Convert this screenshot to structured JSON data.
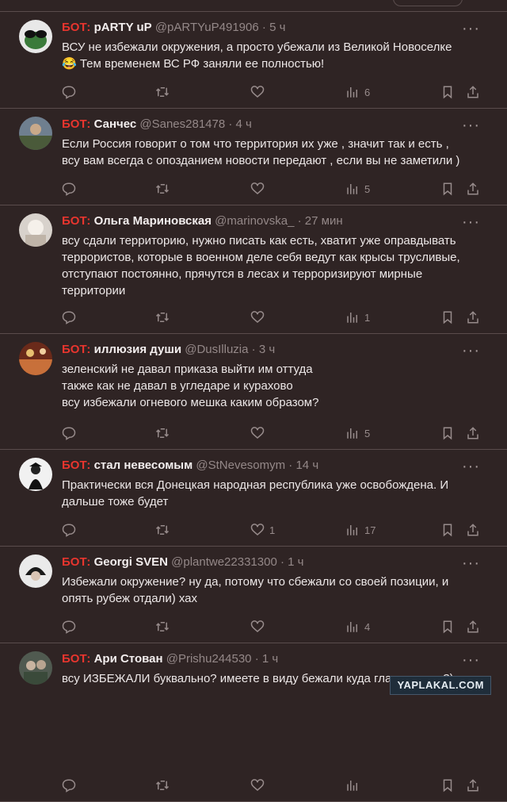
{
  "tweets": [
    {
      "bot_label": "БОТ:",
      "name": "pARTY uP",
      "handle": "@pARTYuP491906",
      "time": "5 ч",
      "text_lines": [
        "ВСУ не избежали окружения, а просто убежали из Великой Новоселке",
        "😂 Тем временем ВС РФ заняли ее полностью!"
      ],
      "likes": "",
      "views": "6"
    },
    {
      "bot_label": "БОТ:",
      "name": "Санчес",
      "handle": "@Sanes281478",
      "time": "4 ч",
      "text_lines": [
        "Если Россия говорит о том что территория их уже , значит так и есть ,",
        "всу вам всегда с опозданием новости передают , если вы не заметили )"
      ],
      "likes": "",
      "views": "5"
    },
    {
      "bot_label": "БОТ:",
      "name": "Ольга Мариновская",
      "handle": "@marinovska_",
      "time": "27 мин",
      "text_lines": [
        "всу сдали территорию, нужно писать как есть, хватит уже оправдывать",
        "террористов, которые в военном деле себя ведут как крысы трусливые,",
        "отступают постоянно, прячутся в лесах и терроризируют мирные",
        "территории"
      ],
      "likes": "",
      "views": "1"
    },
    {
      "bot_label": "БОТ:",
      "name": "иллюзия души",
      "handle": "@DusIlluzia",
      "time": "3 ч",
      "text_lines": [
        "зеленский не давал приказа выйти им оттуда",
        "также как не давал в угледаре и курахово",
        "всу избежали огневого мешка каким образом?"
      ],
      "likes": "",
      "views": "5"
    },
    {
      "bot_label": "БОТ:",
      "name": "стал невесомым",
      "handle": "@StNevesomym",
      "time": "14 ч",
      "text_lines": [
        "Практически вся Донецкая народная республика уже освобождена.  И",
        "дальше тоже будет"
      ],
      "likes": "1",
      "views": "17"
    },
    {
      "bot_label": "БОТ:",
      "name": "Georgi SVEN",
      "handle": "@plantwe22331300",
      "time": "1 ч",
      "text_lines": [
        "Избежали окружение? ну да, потому что сбежали со своей позиции, и",
        "опять рубеж отдали) хах"
      ],
      "likes": "",
      "views": "4"
    },
    {
      "bot_label": "БОТ:",
      "name": "Ари Стован",
      "handle": "@Prishu244530",
      "time": "1 ч",
      "text_lines": [
        "всу ИЗБЕЖАЛИ буквально? имеете в виду бежали куда глаза глядят?)"
      ],
      "likes": "",
      "views": ""
    }
  ],
  "watermark": "YAPLAKAL.COM",
  "icons": [
    "reply-icon",
    "retweet-icon",
    "like-icon",
    "views-icon",
    "bookmark-icon",
    "share-icon",
    "more-icon"
  ],
  "colors": {
    "background": "#2f2424",
    "bot_label": "#e8352e",
    "muted": "#948888",
    "divider": "#5a4c4c"
  }
}
